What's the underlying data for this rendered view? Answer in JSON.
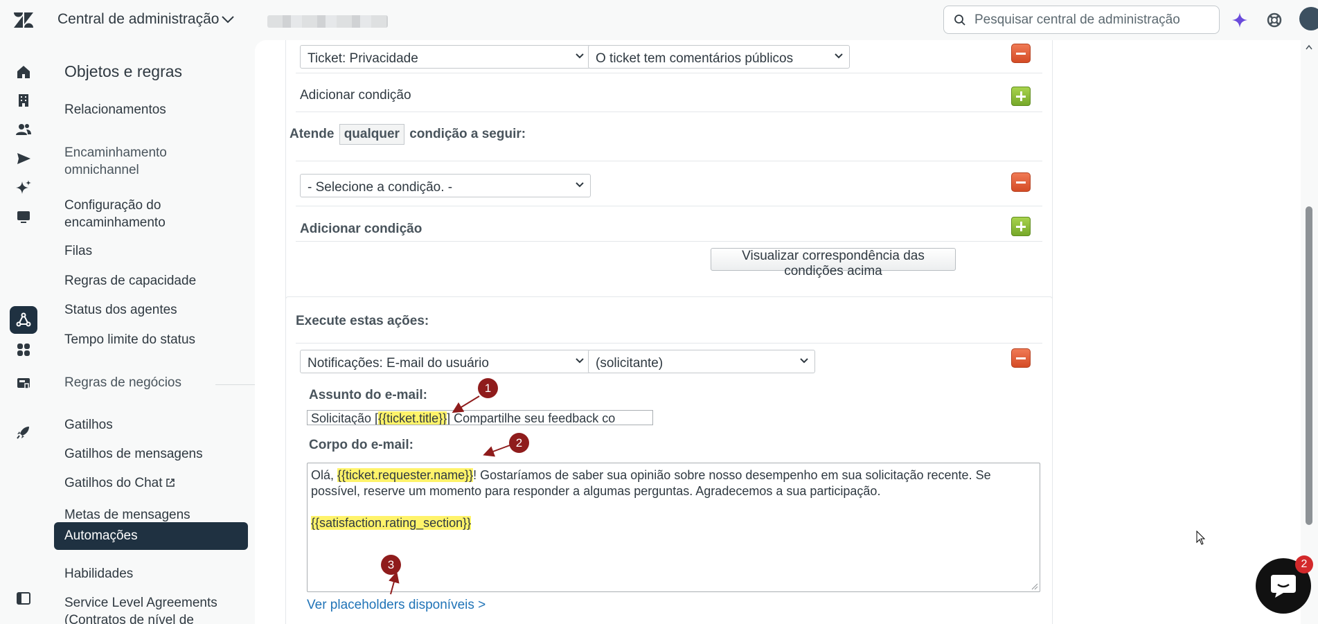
{
  "topbar": {
    "app_title": "Central de administração",
    "search_placeholder": "Pesquisar central de administração"
  },
  "rail": {
    "icons": [
      "home-icon",
      "building-icon",
      "people-icon",
      "send-icon",
      "sparkle-icon",
      "monitor-icon",
      "objects-rules-icon",
      "apps-icon",
      "workspace-icon",
      "rocket-icon",
      "panel-toggle-icon"
    ],
    "active": "objects-rules-icon"
  },
  "nav": {
    "heading": "Objetos e regras",
    "items": [
      {
        "label": "Relacionamentos"
      },
      {
        "label": "Encaminhamento omnichannel"
      },
      {
        "label": "Configuração do encaminhamento"
      },
      {
        "label": "Filas"
      },
      {
        "label": "Regras de capacidade"
      },
      {
        "label": "Status dos agentes"
      },
      {
        "label": "Tempo limite do status"
      },
      {
        "label": "Regras de negócios"
      },
      {
        "label": "Gatilhos"
      },
      {
        "label": "Gatilhos de mensagens"
      },
      {
        "label": "Gatilhos do Chat"
      },
      {
        "label": "Metas de mensagens"
      },
      {
        "label": "Automações"
      },
      {
        "label": "Habilidades"
      },
      {
        "label": "Service Level Agreements (Contratos de nível de"
      }
    ],
    "active_item": "Automações"
  },
  "conditions_all": {
    "condition_field": "Ticket: Privacidade",
    "condition_value": "O ticket tem comentários públicos",
    "add_condition": "Adicionar condição"
  },
  "conditions_any": {
    "prefix": "Atende",
    "keyword": "qualquer",
    "suffix": "condição a seguir:",
    "condition_field": "- Selecione a condição. -",
    "add_condition": "Adicionar condição",
    "preview_button": "Visualizar correspondência das condições acima"
  },
  "actions": {
    "heading": "Execute estas ações:",
    "action_field": "Notificações: E-mail do usuário",
    "action_target": "(solicitante)",
    "subject_label": "Assunto do e-mail:",
    "subject_prefix": "Solicitação [",
    "subject_placeholder": "{{ticket.title}}",
    "subject_suffix": "] Compartilhe seu feedback co",
    "body_label": "Corpo do e-mail:",
    "body_greeting": "Olá, ",
    "body_requester_placeholder": "{{ticket.requester.name}}",
    "body_text": "! Gostaríamos de saber sua opinião sobre nosso desempenho em sua solicitação recente. Se possível, reserve um momento para responder a algumas perguntas. Agradecemos a sua participação.",
    "body_rating_placeholder": "{{satisfaction.rating_section}}",
    "placeholders_link": "Ver placeholders disponíveis >"
  },
  "annotations": [
    "1",
    "2",
    "3"
  ],
  "chat": {
    "badge": "2"
  },
  "colors": {
    "highlight": "#fff36a",
    "marker": "#8f1c1c",
    "link": "#1f73b7",
    "active_nav": "#1f3141"
  }
}
